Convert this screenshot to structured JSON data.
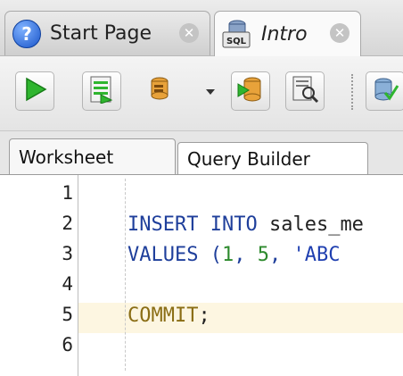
{
  "tabs": [
    {
      "label": "Start Page",
      "icon": "help-icon"
    },
    {
      "label": "Intro",
      "icon": "sql-worksheet-icon"
    }
  ],
  "toolbar": {
    "buttons": [
      "run-statement-icon",
      "run-script-icon",
      "commit-icon",
      "rollback-icon",
      "unshared-sql-icon",
      "sql-tuning-icon"
    ]
  },
  "editor_tabs": [
    "Worksheet",
    "Query Builder"
  ],
  "editor": {
    "line_numbers": [
      "1",
      "2",
      "3",
      "4",
      "5",
      "6"
    ],
    "line2": {
      "kw1": "INSERT",
      "kw2": "INTO",
      "rest": "sales_me"
    },
    "line3": {
      "kw": "VALUES",
      "p1": "(",
      "n1": "1",
      "sep1": ", ",
      "n2": "5",
      "sep2": ", ",
      "s1": "'ABC "
    },
    "line5": {
      "kw": "COMMIT",
      "rest": ";"
    }
  },
  "colors": {
    "keyword": "#1f3f9b",
    "number": "#2d8a2d",
    "string": "#1f3fb0",
    "current_line": "#fdf6e1"
  }
}
